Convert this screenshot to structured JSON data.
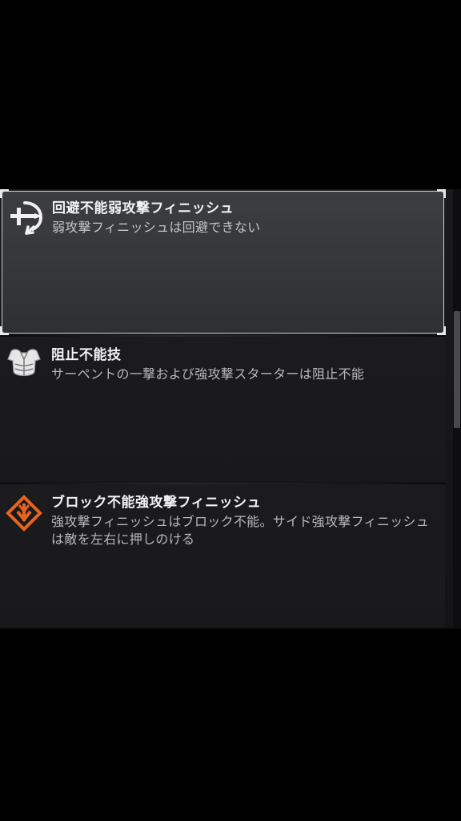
{
  "abilities": [
    {
      "title": "回避不能弱攻撃フィニッシュ",
      "description": "弱攻撃フィニッシュは回避できない",
      "icon": "unblockable-light-finisher-icon",
      "selected": true
    },
    {
      "title": "阻止不能技",
      "description": "サーペントの一撃および強攻撃スターターは阻止不能",
      "icon": "armor-chest-icon",
      "selected": false
    },
    {
      "title": "ブロック不能強攻撃フィニッシュ",
      "description": "強攻撃フィニッシュはブロック不能。サイド強攻撃フィニッシュは敵を左右に押しのける",
      "icon": "unblockable-orange-diamond-icon",
      "selected": false
    }
  ],
  "colors": {
    "accent_orange": "#e8641e",
    "icon_white": "#f0f0f0"
  }
}
